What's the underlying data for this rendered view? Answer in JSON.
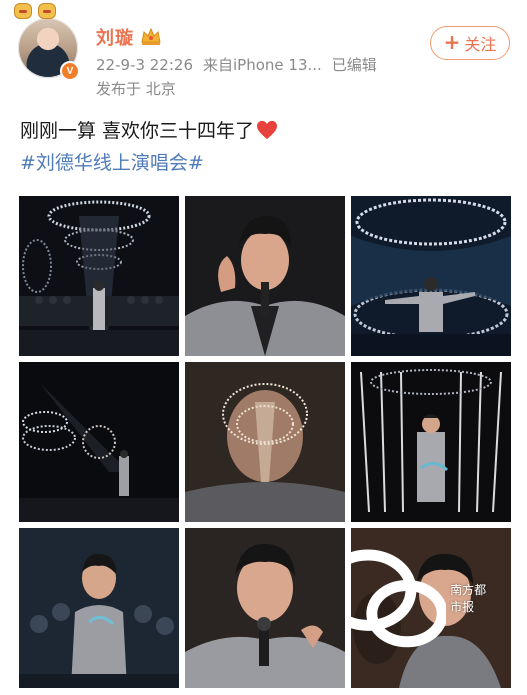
{
  "user": {
    "name": "刘璇",
    "timestamp": "22-9-3 22:26",
    "source": "来自iPhone 13...",
    "edited": "已编辑",
    "location": "发布于 北京",
    "verified_badge": "V"
  },
  "follow_button": {
    "plus": "+",
    "label": "关注"
  },
  "post": {
    "text": "刚刚一算  喜欢你三十四年了",
    "hashtag": "#刘德华线上演唱会#"
  },
  "images": [
    "concert-stage-wide",
    "singer-closeup-ear",
    "singer-stage-arms-open",
    "stage-lights-rings",
    "singer-face-overlay-rings",
    "singer-stage-lightbars",
    "singer-with-dancers",
    "singer-closeup-mic",
    "singer-smiling-closeup"
  ],
  "watermark": {
    "label": "南方都市报"
  },
  "colors": {
    "accent": "#eb7350",
    "link": "#4f7cb8",
    "meta": "#8a8a8a"
  }
}
